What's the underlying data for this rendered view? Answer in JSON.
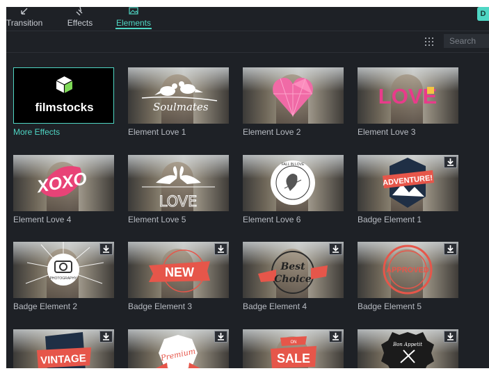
{
  "tabs": [
    {
      "label": "Transition",
      "icon": "transition-icon",
      "active": false
    },
    {
      "label": "Effects",
      "icon": "effects-icon",
      "active": false
    },
    {
      "label": "Elements",
      "icon": "elements-icon",
      "active": true
    }
  ],
  "corner_button_label": "D",
  "toolbar": {
    "search_placeholder": "Search",
    "grid_icon": "grid-view-icon"
  },
  "colors": {
    "accent": "#4fd6c4",
    "background": "#1e2126",
    "caption": "#b8bcc3"
  },
  "items": [
    {
      "caption": "More Effects",
      "download": false,
      "art": "filmstocks"
    },
    {
      "caption": "Element Love 1",
      "download": false,
      "art": "soulmates"
    },
    {
      "caption": "Element Love 2",
      "download": false,
      "art": "heart"
    },
    {
      "caption": "Element Love 3",
      "download": false,
      "art": "love-pink"
    },
    {
      "caption": "Element Love 4",
      "download": false,
      "art": "xoxo"
    },
    {
      "caption": "Element Love 5",
      "download": false,
      "art": "swans-love"
    },
    {
      "caption": "Element Love 6",
      "download": false,
      "art": "cupid"
    },
    {
      "caption": "Badge Element 1",
      "download": true,
      "art": "adventure"
    },
    {
      "caption": "Badge Element 2",
      "download": true,
      "art": "photography"
    },
    {
      "caption": "Badge Element 3",
      "download": true,
      "art": "new"
    },
    {
      "caption": "Badge Element 4",
      "download": true,
      "art": "best-choice"
    },
    {
      "caption": "Badge Element 5",
      "download": true,
      "art": "approved"
    },
    {
      "caption": "",
      "download": true,
      "art": "vintage"
    },
    {
      "caption": "",
      "download": true,
      "art": "premium"
    },
    {
      "caption": "",
      "download": true,
      "art": "sale"
    },
    {
      "caption": "",
      "download": true,
      "art": "bon-appetit"
    }
  ],
  "art_text": {
    "filmstocks": "filmstocks",
    "soulmates": "Soulmates",
    "xoxo": "XOXO",
    "love": "LOVE",
    "cupid_ring": "FALL IN LOVE",
    "adventure": "ADVENTURE!",
    "photography": "PHOTOGRAPHY",
    "new": "NEW",
    "best": "Best",
    "choice": "Choice",
    "approved": "APPROVED",
    "vintage": "VINTAGE",
    "premium": "Premium",
    "sale_top": "ON",
    "sale": "SALE",
    "bon_appetit": "Bon Appetit"
  }
}
